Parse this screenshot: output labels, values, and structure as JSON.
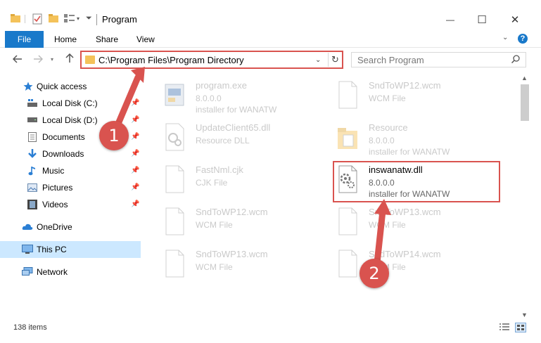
{
  "window": {
    "title": "Program",
    "minimize_glyph": "—",
    "maximize_glyph": "☐",
    "close_glyph": "✕"
  },
  "ribbon": {
    "file": "File",
    "home": "Home",
    "share": "Share",
    "view": "View",
    "help": "?"
  },
  "address": {
    "path": "C:\\Program Files\\Program Directory"
  },
  "search": {
    "placeholder": "Search Program"
  },
  "sidebar": {
    "items": [
      {
        "label": "Quick access"
      },
      {
        "label": "Local Disk (C:)"
      },
      {
        "label": "Local Disk (D:)"
      },
      {
        "label": "Documents"
      },
      {
        "label": "Downloads"
      },
      {
        "label": "Music"
      },
      {
        "label": "Pictures"
      },
      {
        "label": "Videos"
      },
      {
        "label": "OneDrive"
      },
      {
        "label": "This PC"
      },
      {
        "label": "Network"
      }
    ]
  },
  "files": [
    {
      "name": "program.exe",
      "line1": "8.0.0.0",
      "line2": "installer for WANATW",
      "icon": "exe-icon"
    },
    {
      "name": "SndToWP12.wcm",
      "line1": "WCM File",
      "line2": "",
      "icon": "blank-file-icon"
    },
    {
      "name": "UpdateClient65.dll",
      "line1": "Resource DLL",
      "line2": "",
      "icon": "dll-icon"
    },
    {
      "name": "Resource",
      "line1": "8.0.0.0",
      "line2": "installer for WANATW",
      "icon": "folder-icon"
    },
    {
      "name": "FastNml.cjk",
      "line1": "CJK File",
      "line2": "",
      "icon": "blank-file-icon"
    },
    {
      "name": "inswanatw.dll",
      "line1": "8.0.0.0",
      "line2": "installer for WANATW",
      "icon": "dll-gear-icon"
    },
    {
      "name": "SndToWP12.wcm",
      "line1": "WCM File",
      "line2": "",
      "icon": "blank-file-icon"
    },
    {
      "name": "SndToWP13.wcm",
      "line1": "WCM File",
      "line2": "",
      "icon": "blank-file-icon"
    },
    {
      "name": "SndToWP13.wcm",
      "line1": "WCM File",
      "line2": "",
      "icon": "blank-file-icon"
    },
    {
      "name": "SndToWP14.wcm",
      "line1": "WCM File",
      "line2": "",
      "icon": "blank-file-icon"
    }
  ],
  "status": {
    "items_count": "138 items"
  },
  "annotations": {
    "step1": "1",
    "step2": "2",
    "color": "#d9534f"
  }
}
